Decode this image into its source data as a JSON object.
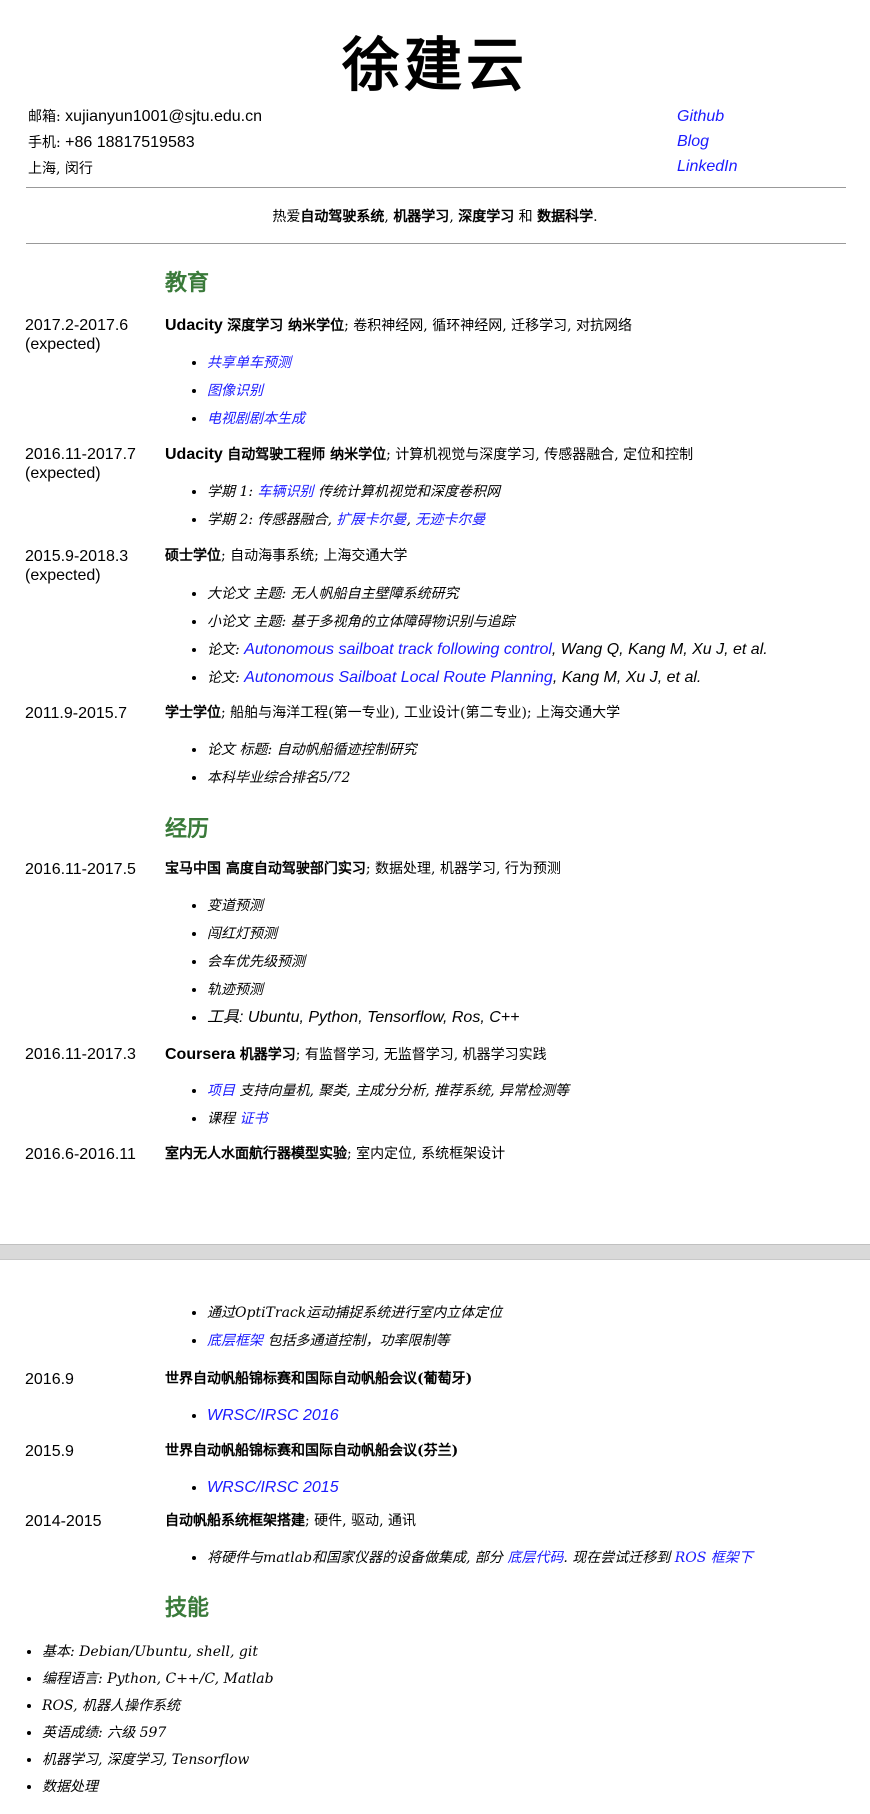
{
  "name": "徐建云",
  "contact": {
    "email_label": "邮箱:",
    "email": "xujianyun1001@sjtu.edu.cn",
    "phone_label": "手机:",
    "phone": "+86 18817519583",
    "location": "上海, 闵行"
  },
  "links": {
    "github": "Github",
    "blog": "Blog",
    "linkedin": "LinkedIn"
  },
  "tagline": {
    "prefix": "热爱",
    "t1": "自动驾驶系统",
    "sep1": ", ",
    "t2": "机器学习",
    "sep2": ", ",
    "t3": "深度学习",
    "and": " 和 ",
    "t4": "数据科学",
    "end": "."
  },
  "sections": {
    "education": "教育",
    "experience": "经历",
    "skills": "技能"
  },
  "education": [
    {
      "date": "2017.2-2017.6",
      "date_note": "(expected)",
      "org": "Udacity",
      "title": "深度学习 纳米学位",
      "desc": "; 卷积神经网, 循环神经网, 迁移学习, 对抗网络",
      "items": [
        "共享单车预测",
        "图像识别",
        "电视剧剧本生成"
      ]
    },
    {
      "date": "2016.11-2017.7",
      "date_note": "(expected)",
      "org": "Udacity",
      "title": "自动驾驶工程师 纳米学位",
      "desc": "; 计算机视觉与深度学习, 传感器融合, 定位和控制",
      "items": [
        {
          "prefix": "学期 1: ",
          "link": "车辆识别",
          "suffix": " 传统计算机视觉和深度卷积网"
        },
        {
          "prefix": "学期 2: 传感器融合, ",
          "link": "扩展卡尔曼",
          "mid": ", ",
          "link2": "无迹卡尔曼"
        }
      ]
    },
    {
      "date": "2015.9-2018.3",
      "date_note": "(expected)",
      "title": "硕士学位",
      "desc": "; 自动海事系统; 上海交通大学",
      "items": [
        {
          "text": "大论文 主题: 无人帆船自主壁障系统研究"
        },
        {
          "text": "小论文 主题: 基于多视角的立体障碍物识别与追踪"
        },
        {
          "prefix": "论文: ",
          "link": "Autonomous sailboat track following control",
          "suffix": ", Wang Q, Kang M, Xu J, et al."
        },
        {
          "prefix": "论文: ",
          "link": "Autonomous Sailboat Local Route Planning",
          "suffix": ", Kang M, Xu J, et al."
        }
      ]
    },
    {
      "date": "2011.9-2015.7",
      "title": "学士学位",
      "desc": "; 船舶与海洋工程(第一专业), 工业设计(第二专业); 上海交通大学",
      "items": [
        "论文 标题: 自动帆船循迹控制研究",
        "本科毕业综合排名5/72"
      ]
    }
  ],
  "experience": [
    {
      "date": "2016.11-2017.5",
      "title": "宝马中国 高度自动驾驶部门实习",
      "desc": "; 数据处理, 机器学习, 行为预测",
      "items": [
        "变道预测",
        "闯红灯预测",
        "会车优先级预测",
        "轨迹预测",
        "工具: Ubuntu, Python, Tensorflow, Ros, C++"
      ]
    },
    {
      "date": "2016.11-2017.3",
      "org": "Coursera",
      "title": "机器学习",
      "desc": "; 有监督学习, 无监督学习, 机器学习实践",
      "items": [
        {
          "link": "项目",
          "suffix": " 支持向量机, 聚类, 主成分分析, 推荐系统, 异常检测等"
        },
        {
          "prefix": "课程 ",
          "link": "证书"
        }
      ]
    },
    {
      "date": "2016.6-2016.11",
      "title": "室内无人水面航行器模型实验",
      "desc": "; 室内定位, 系统框架设计",
      "items": [
        {
          "text": "通过OptiTrack运动捕捉系统进行室内立体定位"
        },
        {
          "link": "底层框架",
          "suffix": " 包括多通道控制，功率限制等"
        }
      ]
    },
    {
      "date": "2016.9",
      "title": "世界自动帆船锦标赛和国际自动帆船会议(葡萄牙)",
      "items": [
        {
          "link": "WRSC/IRSC 2016"
        }
      ]
    },
    {
      "date": "2015.9",
      "title": "世界自动帆船锦标赛和国际自动帆船会议(芬兰)",
      "items": [
        {
          "link": "WRSC/IRSC 2015"
        }
      ]
    },
    {
      "date": "2014-2015",
      "title": "自动帆船系统框架搭建",
      "desc": "; 硬件, 驱动, 通讯",
      "items": [
        {
          "prefix": "将硬件与matlab和国家仪器的设备做集成, 部分 ",
          "link": "底层代码",
          "mid": ". 现在尝试迁移到 ",
          "link2": "ROS 框架下"
        }
      ]
    }
  ],
  "skills": [
    "基本: Debian/Ubuntu, shell, git",
    "编程语言: Python, C++/C, Matlab",
    "ROS, 机器人操作系统",
    "英语成绩: 六级 597",
    "机器学习, 深度学习, Tensorflow",
    "数据处理"
  ]
}
